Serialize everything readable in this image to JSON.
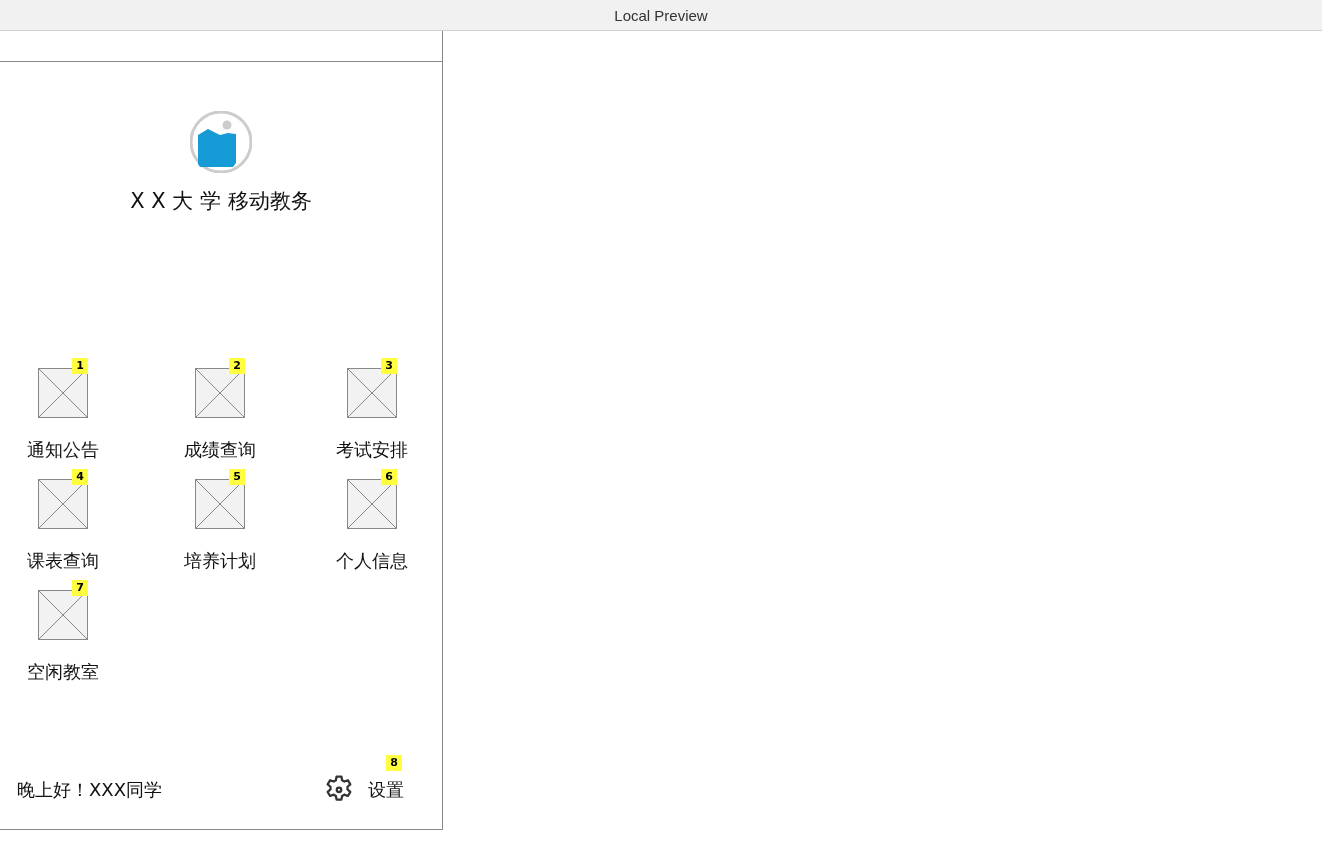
{
  "window": {
    "title": "Local Preview"
  },
  "app": {
    "title": "X X 大 学 移动教务"
  },
  "menu": [
    {
      "label": "通知公告",
      "badge": "1"
    },
    {
      "label": "成绩查询",
      "badge": "2"
    },
    {
      "label": "考试安排",
      "badge": "3"
    },
    {
      "label": "课表查询",
      "badge": "4"
    },
    {
      "label": "培养计划",
      "badge": "5"
    },
    {
      "label": "个人信息",
      "badge": "6"
    },
    {
      "label": "空闲教室",
      "badge": "7"
    }
  ],
  "footer": {
    "greeting": "晚上好！XXX同学",
    "settings": {
      "label": "设置",
      "badge": "8"
    }
  }
}
